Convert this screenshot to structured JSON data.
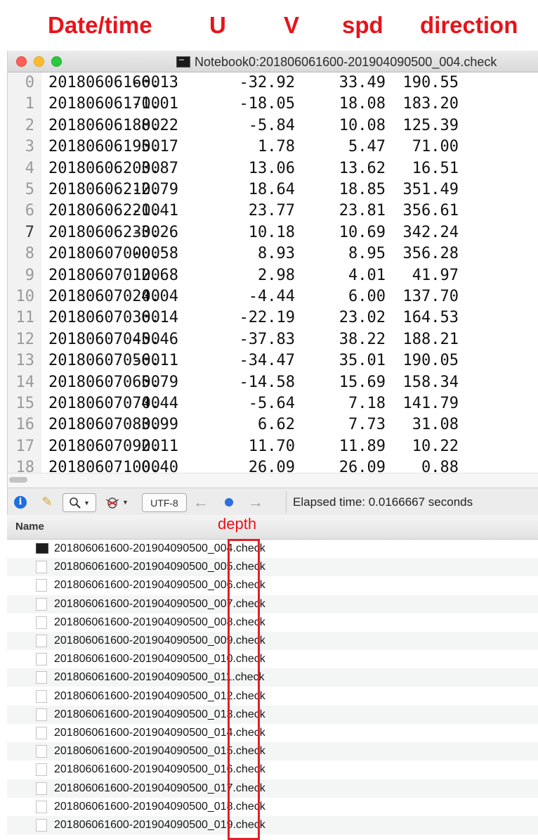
{
  "annotations": {
    "headers": [
      "Date/time",
      "U",
      "V",
      "spd",
      "direction"
    ],
    "depth_label": "depth"
  },
  "window": {
    "title": "Notebook0:201806061600-201904090500_004.check"
  },
  "data_rows": [
    {
      "n": "0",
      "date": "201806061600",
      "u": "-6.13",
      "v": "-32.92",
      "spd": "33.49",
      "dir": "190.55"
    },
    {
      "n": "1",
      "date": "201806061700",
      "u": "-1.01",
      "v": "-18.05",
      "spd": "18.08",
      "dir": "183.20"
    },
    {
      "n": "2",
      "date": "201806061800",
      "u": "8.22",
      "v": "-5.84",
      "spd": "10.08",
      "dir": "125.39"
    },
    {
      "n": "3",
      "date": "201806061900",
      "u": "5.17",
      "v": "1.78",
      "spd": "5.47",
      "dir": "71.00"
    },
    {
      "n": "4",
      "date": "201806062000",
      "u": "3.87",
      "v": "13.06",
      "spd": "13.62",
      "dir": "16.51"
    },
    {
      "n": "5",
      "date": "201806062100",
      "u": "-2.79",
      "v": "18.64",
      "spd": "18.85",
      "dir": "351.49"
    },
    {
      "n": "6",
      "date": "201806062200",
      "u": "-1.41",
      "v": "23.77",
      "spd": "23.81",
      "dir": "356.61"
    },
    {
      "n": "7",
      "date": "201806062300",
      "u": "-3.26",
      "v": "10.18",
      "spd": "10.69",
      "dir": "342.24"
    },
    {
      "n": "8",
      "date": "201806070000",
      "u": "-0.58",
      "v": "8.93",
      "spd": "8.95",
      "dir": "356.28"
    },
    {
      "n": "9",
      "date": "201806070100",
      "u": "2.68",
      "v": "2.98",
      "spd": "4.01",
      "dir": "41.97"
    },
    {
      "n": "10",
      "date": "201806070200",
      "u": "4.04",
      "v": "-4.44",
      "spd": "6.00",
      "dir": "137.70"
    },
    {
      "n": "11",
      "date": "201806070300",
      "u": "6.14",
      "v": "-22.19",
      "spd": "23.02",
      "dir": "164.53"
    },
    {
      "n": "12",
      "date": "201806070400",
      "u": "-5.46",
      "v": "-37.83",
      "spd": "38.22",
      "dir": "188.21"
    },
    {
      "n": "13",
      "date": "201806070500",
      "u": "-6.11",
      "v": "-34.47",
      "spd": "35.01",
      "dir": "190.05"
    },
    {
      "n": "14",
      "date": "201806070600",
      "u": "5.79",
      "v": "-14.58",
      "spd": "15.69",
      "dir": "158.34"
    },
    {
      "n": "15",
      "date": "201806070700",
      "u": "4.44",
      "v": "-5.64",
      "spd": "7.18",
      "dir": "141.79"
    },
    {
      "n": "16",
      "date": "201806070800",
      "u": "3.99",
      "v": "6.62",
      "spd": "7.73",
      "dir": "31.08"
    },
    {
      "n": "17",
      "date": "201806070900",
      "u": "2.11",
      "v": "11.70",
      "spd": "11.89",
      "dir": "10.22"
    },
    {
      "n": "18",
      "date": "201806071000",
      "u": "0.40",
      "v": "26.09",
      "spd": "26.09",
      "dir": "0.88"
    }
  ],
  "statusbar": {
    "encoding": "UTF-8",
    "elapsed": "Elapsed time: 0.0166667 seconds"
  },
  "finder": {
    "column_name": "Name",
    "files": [
      "201806061600-201904090500_004.check",
      "201806061600-201904090500_005.check",
      "201806061600-201904090500_006.check",
      "201806061600-201904090500_007.check",
      "201806061600-201904090500_008.check",
      "201806061600-201904090500_009.check",
      "201806061600-201904090500_010.check",
      "201806061600-201904090500_011.check",
      "201806061600-201904090500_012.check",
      "201806061600-201904090500_013.check",
      "201806061600-201904090500_014.check",
      "201806061600-201904090500_015.check",
      "201806061600-201904090500_016.check",
      "201806061600-201904090500_017.check",
      "201806061600-201904090500_018.check",
      "201806061600-201904090500_019.check"
    ]
  },
  "colors": {
    "annotation_red": "#e8131a",
    "selection_blue": "#2e6fe0"
  }
}
